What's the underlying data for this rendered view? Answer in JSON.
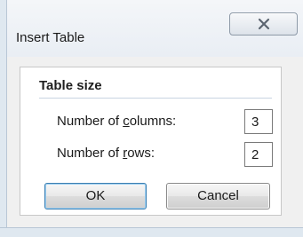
{
  "dialog": {
    "title": "Insert Table"
  },
  "title_bar": {
    "close_icon": "close-icon"
  },
  "table_size": {
    "group_title": "Table size",
    "columns_label_pre": "Number of ",
    "columns_label_mnemonic": "c",
    "columns_label_post": "olumns:",
    "columns_value": "3",
    "rows_label_pre": "Number of ",
    "rows_label_mnemonic": "r",
    "rows_label_post": "ows:",
    "rows_value": "2"
  },
  "buttons": {
    "ok_label": "OK",
    "cancel_label": "Cancel"
  },
  "colors": {
    "default_button_border": "#3c7fb1",
    "client_background": "#f0f0f0"
  }
}
